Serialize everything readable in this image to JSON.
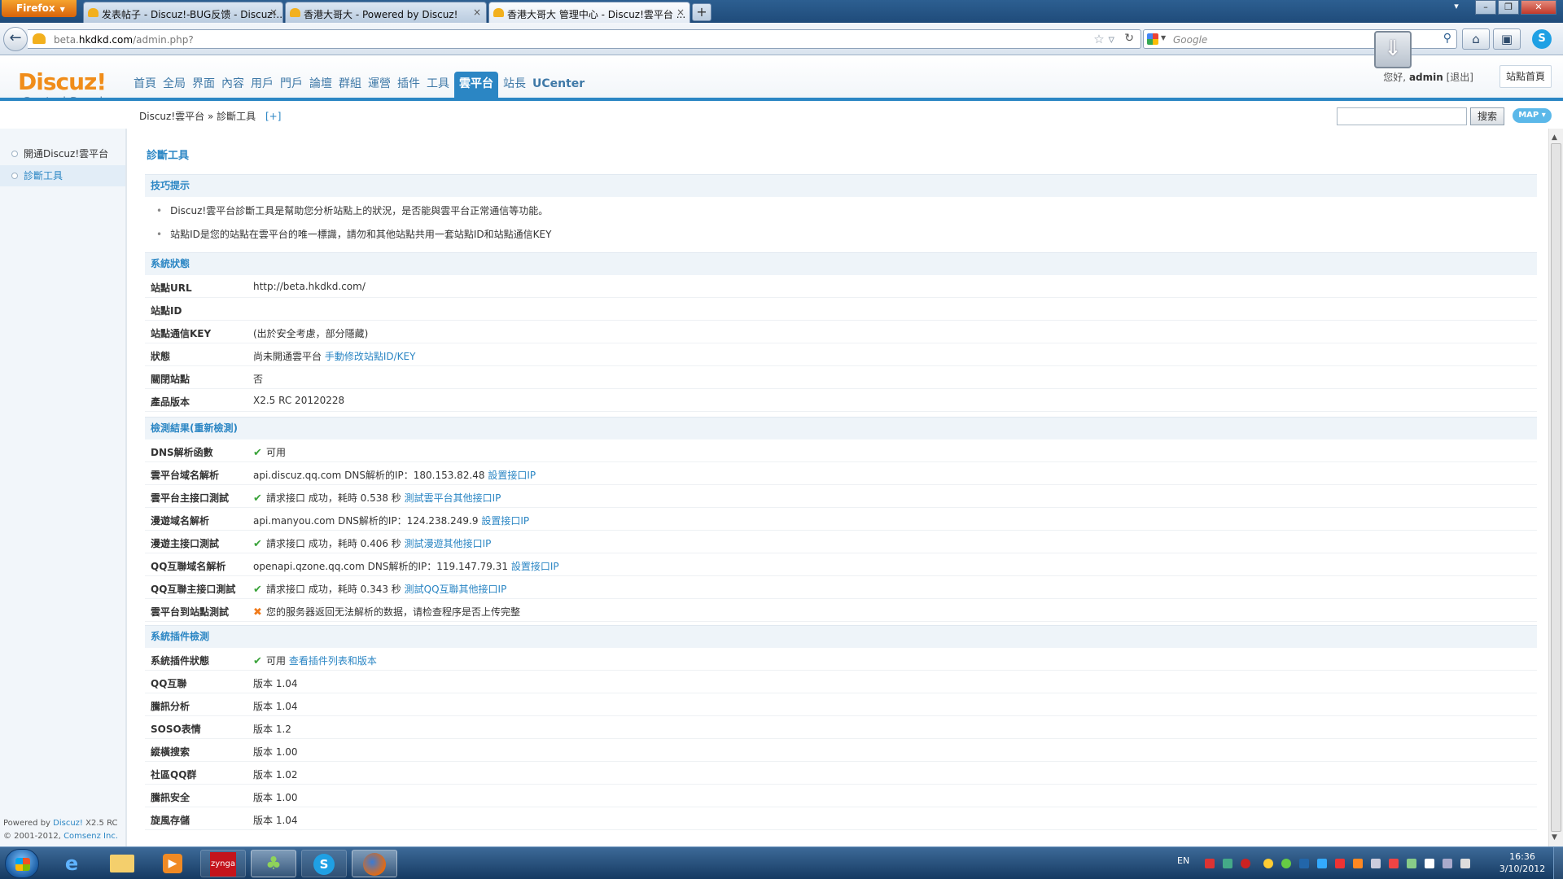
{
  "browser": {
    "menu_label": "Firefox",
    "tabs": [
      {
        "title": "发表帖子 - Discuz!-BUG反馈 - Discuz!..."
      },
      {
        "title": "香港大哥大 - Powered by Discuz!"
      },
      {
        "title": "香港大哥大 管理中心 - Discuz!雲平台 ..."
      }
    ],
    "url_prefix": "beta.",
    "url_domain": "hkdkd.com",
    "url_path": "/admin.php?",
    "search_placeholder": "Google"
  },
  "header": {
    "logo_title": "Discuz!",
    "logo_subtitle": "Control Panel",
    "nav": [
      "首頁",
      "全局",
      "界面",
      "內容",
      "用戶",
      "門戶",
      "論壇",
      "群組",
      "運營",
      "插件",
      "工具",
      "雲平台",
      "站長",
      "UCenter"
    ],
    "active_nav": "雲平台",
    "greeting": "您好,",
    "username": "admin",
    "logout": "[退出]",
    "home_link": "站點首頁"
  },
  "breadcrumb": {
    "root": "Discuz!雲平台",
    "sep": "»",
    "current": "診斷工具",
    "plus": "[+]"
  },
  "search": {
    "button": "搜索",
    "map_button": "MAP ▾"
  },
  "sidebar": {
    "items": [
      {
        "label": "開通Discuz!雲平台"
      },
      {
        "label": "診斷工具"
      }
    ],
    "footer_powered_prefix": "Powered by",
    "footer_powered_link": "Discuz!",
    "footer_version": "X2.5 RC",
    "footer_copy": "© 2001-2012,",
    "footer_company": "Comsenz Inc."
  },
  "main": {
    "page_title": "診斷工具",
    "tips_title": "技巧提示",
    "tips": [
      "Discuz!雲平台診斷工具是幫助您分析站點上的狀況，是否能與雲平台正常通信等功能。",
      "站點ID是您的站點在雲平台的唯一標識，請勿和其他站點共用一套站點ID和站點通信KEY"
    ],
    "system_title": "系統狀態",
    "system": [
      {
        "label": "站點URL",
        "value": "http://beta.hkdkd.com/"
      },
      {
        "label": "站點ID",
        "value": ""
      },
      {
        "label": "站點通信KEY",
        "value": "(出於安全考慮，部分隱藏)"
      },
      {
        "label": "狀態",
        "value": "尚未開通雲平台",
        "link": "手動修改站點ID/KEY"
      },
      {
        "label": "關閉站點",
        "value": "否"
      },
      {
        "label": "產品版本",
        "value": "X2.5 RC 20120228"
      }
    ],
    "check_title": "檢測結果(重新檢測)",
    "checks": [
      {
        "label": "DNS解析函數",
        "icon": "ok",
        "value": "可用",
        "link": ""
      },
      {
        "label": "雲平台域名解析",
        "icon": "",
        "value": "api.discuz.qq.com DNS解析的IP：180.153.82.48",
        "link": "設置接口IP"
      },
      {
        "label": "雲平台主接口測試",
        "icon": "ok",
        "value": "請求接口 成功，耗時 0.538 秒",
        "link": "測試雲平台其他接口IP"
      },
      {
        "label": "漫遊域名解析",
        "icon": "",
        "value": "api.manyou.com DNS解析的IP：124.238.249.9",
        "link": "設置接口IP"
      },
      {
        "label": "漫遊主接口測試",
        "icon": "ok",
        "value": "請求接口 成功，耗時 0.406 秒",
        "link": "測試漫遊其他接口IP"
      },
      {
        "label": "QQ互聯域名解析",
        "icon": "",
        "value": "openapi.qzone.qq.com DNS解析的IP：119.147.79.31",
        "link": "設置接口IP"
      },
      {
        "label": "QQ互聯主接口測試",
        "icon": "ok",
        "value": "請求接口 成功，耗時 0.343 秒",
        "link": "測試QQ互聯其他接口IP"
      },
      {
        "label": "雲平台到站點測試",
        "icon": "bad",
        "value": "您的服务器返回无法解析的数据，请检查程序是否上传完整",
        "link": ""
      }
    ],
    "plugin_title": "系統插件檢測",
    "plugins": [
      {
        "label": "系統插件狀態",
        "icon": "ok",
        "value": "可用",
        "link": "查看插件列表和版本"
      },
      {
        "label": "QQ互聯",
        "icon": "",
        "value": "版本 1.04",
        "link": ""
      },
      {
        "label": "騰訊分析",
        "icon": "",
        "value": "版本 1.04",
        "link": ""
      },
      {
        "label": "SOSO表情",
        "icon": "",
        "value": "版本 1.2",
        "link": ""
      },
      {
        "label": "縱橫搜索",
        "icon": "",
        "value": "版本 1.00",
        "link": ""
      },
      {
        "label": "社區QQ群",
        "icon": "",
        "value": "版本 1.02",
        "link": ""
      },
      {
        "label": "騰訊安全",
        "icon": "",
        "value": "版本 1.00",
        "link": ""
      },
      {
        "label": "旋風存儲",
        "icon": "",
        "value": "版本 1.04",
        "link": ""
      }
    ]
  },
  "taskbar": {
    "lang": "EN",
    "time": "16:36",
    "date": "3/10/2012",
    "zynga_label": "zynga"
  },
  "colors": {
    "accent": "#2b86c4",
    "logo_orange": "#f08d1a",
    "ok_green": "#3aa33a",
    "error_orange": "#f07a1a"
  },
  "icons": [
    "back-arrow-icon",
    "bookmark-star-icon",
    "reload-icon",
    "search-icon",
    "home-icon",
    "download-icon",
    "skype-icon",
    "check-icon",
    "cross-icon"
  ]
}
